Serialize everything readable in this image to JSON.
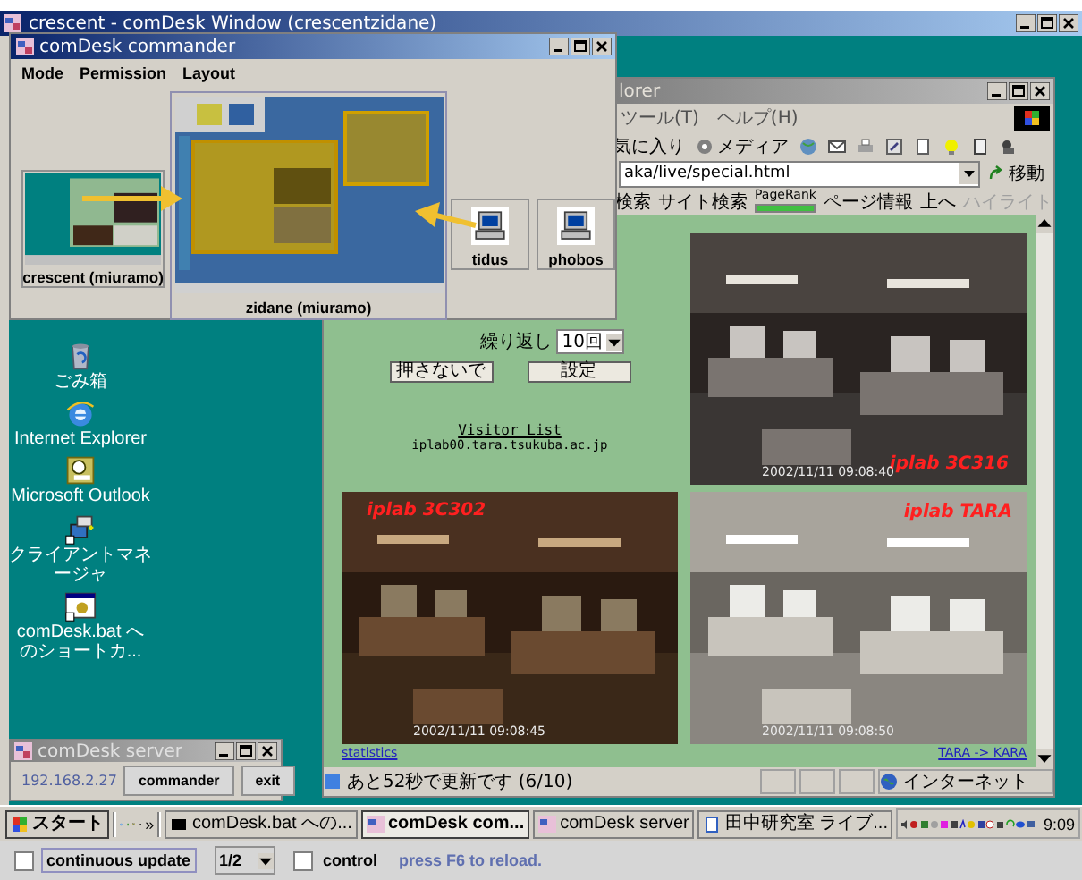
{
  "outer_window": {
    "title": "crescent - comDesk Window (crescentzidane)"
  },
  "commander": {
    "title": "comDesk commander",
    "menu": [
      "Mode",
      "Permission",
      "Layout"
    ],
    "hosts": [
      {
        "label": "crescent (miuramo)",
        "kind": "thumbnail"
      },
      {
        "label": "zidane (miuramo)",
        "kind": "desktop"
      },
      {
        "label": "tidus",
        "kind": "computer"
      },
      {
        "label": "phobos",
        "kind": "computer"
      }
    ]
  },
  "desktop_icons": [
    {
      "label": "ごみ箱",
      "kind": "trash"
    },
    {
      "label": "Internet Explorer",
      "kind": "browser"
    },
    {
      "label": "Microsoft Outlook",
      "kind": "mail"
    },
    {
      "label": "クライアントマネージャ",
      "kind": "network"
    },
    {
      "label": "comDesk.bat へのショートカ...",
      "kind": "batch"
    }
  ],
  "browser": {
    "title": "lorer",
    "menu": [
      "ツール(T)",
      "ヘルプ(H)"
    ],
    "toolbar": [
      "気に入り",
      "メディア"
    ],
    "address": "aka/live/special.html",
    "go": "移動",
    "links": [
      {
        "label": "検索",
        "disabled": false
      },
      {
        "label": "サイト検索",
        "disabled": false
      },
      {
        "label": "PageRank",
        "disabled": false
      },
      {
        "label": "ページ情報",
        "disabled": false
      },
      {
        "label": "上へ",
        "disabled": false
      },
      {
        "label": "ハイライト",
        "disabled": true
      }
    ],
    "repeat_label": "繰り返し",
    "repeat_value": "10回",
    "buttons": [
      "押さないで",
      "設定"
    ],
    "visitor_link": "Visitor List",
    "host": "iplab00.tara.tsukuba.ac.jp",
    "cameras": [
      {
        "kind": "control"
      },
      {
        "kind": "camera",
        "label": "iplab 3C316",
        "time": "2002/11/11 09:08:40"
      },
      {
        "kind": "camera",
        "label": "iplab 3C302",
        "time": "2002/11/11 09:08:45"
      },
      {
        "kind": "camera",
        "label": "iplab TARA",
        "time": "2002/11/11 09:08:50"
      }
    ],
    "statistics_link": "statistics",
    "nav_link": "TARA -> KARA",
    "status": "あと52秒で更新です (6/10)",
    "zone": "インターネット"
  },
  "server": {
    "title": "comDesk server",
    "ip": "192.168.2.27",
    "buttons": [
      "commander",
      "exit"
    ]
  },
  "taskbar": {
    "start": "スタート",
    "chevron": "»",
    "tasks": [
      {
        "label": "comDesk.bat への...",
        "selected": false
      },
      {
        "label": "comDesk com...",
        "selected": true
      },
      {
        "label": "comDesk server",
        "selected": false
      },
      {
        "label": "田中研究室 ライブ...",
        "selected": false
      }
    ],
    "clock": "9:09"
  },
  "bottom_bar": {
    "continuous_update": {
      "label": "continuous update",
      "checked": false
    },
    "page": "1/2",
    "control": {
      "label": "control",
      "checked": false
    },
    "hint": "press F6 to reload."
  }
}
